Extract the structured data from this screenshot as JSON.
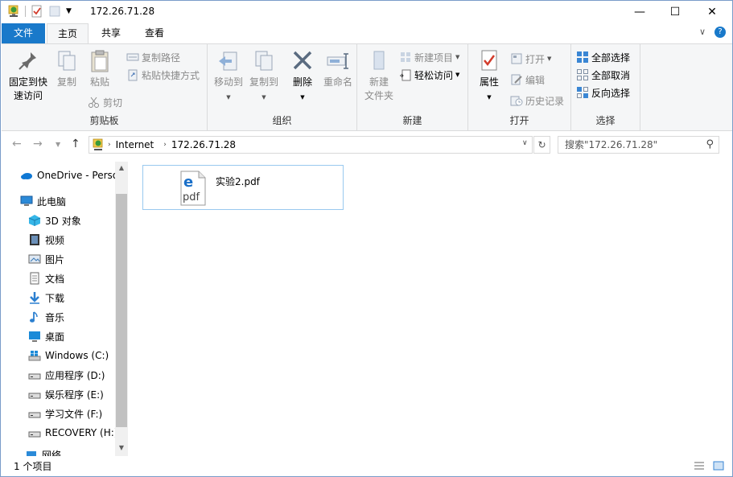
{
  "window": {
    "title": "172.26.71.28",
    "minimize_glyph": "—",
    "maximize_glyph": "☐",
    "close_glyph": "✕"
  },
  "tabs": {
    "file": "文件",
    "home": "主页",
    "share": "共享",
    "view": "查看",
    "collapse_glyph": "∨",
    "help_glyph": "?"
  },
  "ribbon": {
    "clipboard": {
      "label": "剪贴板",
      "pin": "固定到快\n速访问",
      "pin_l1": "固定到快",
      "pin_l2": "速访问",
      "copy": "复制",
      "paste": "粘贴",
      "copy_path": "复制路径",
      "paste_shortcut": "粘贴快捷方式",
      "cut": "剪切"
    },
    "organize": {
      "label": "组织",
      "move_to": "移动到",
      "copy_to": "复制到",
      "delete": "删除",
      "rename": "重命名"
    },
    "new": {
      "label": "新建",
      "new_folder_l1": "新建",
      "new_folder_l2": "文件夹",
      "new_item": "新建项目",
      "easy_access": "轻松访问"
    },
    "open": {
      "label": "打开",
      "properties": "属性",
      "open": "打开",
      "edit": "编辑",
      "history": "历史记录"
    },
    "select": {
      "label": "选择",
      "select_all": "全部选择",
      "select_none": "全部取消",
      "invert": "反向选择"
    }
  },
  "address": {
    "root": "Internet",
    "current": "172.26.71.28",
    "search_placeholder": "搜索\"172.26.71.28\""
  },
  "navpane": {
    "items": [
      {
        "label": "OneDrive - Perso",
        "icon": "cloud-icon"
      },
      {
        "label": "此电脑",
        "icon": "computer-icon"
      },
      {
        "label": "3D 对象",
        "icon": "cube-icon"
      },
      {
        "label": "视频",
        "icon": "video-icon"
      },
      {
        "label": "图片",
        "icon": "picture-icon"
      },
      {
        "label": "文档",
        "icon": "document-icon"
      },
      {
        "label": "下载",
        "icon": "download-icon"
      },
      {
        "label": "音乐",
        "icon": "music-icon"
      },
      {
        "label": "桌面",
        "icon": "desktop-icon"
      },
      {
        "label": "Windows (C:)",
        "icon": "windows-drive-icon"
      },
      {
        "label": "应用程序 (D:)",
        "icon": "drive-icon"
      },
      {
        "label": "娱乐程序 (E:)",
        "icon": "drive-icon"
      },
      {
        "label": "学习文件 (F:)",
        "icon": "drive-icon"
      },
      {
        "label": "RECOVERY (H:)",
        "icon": "drive-icon"
      },
      {
        "label": "网络",
        "icon": "network-icon"
      }
    ]
  },
  "files": [
    {
      "name": "实验2.pdf",
      "icon": "pdf-edge-icon"
    }
  ],
  "status": {
    "count": "1 个项目"
  },
  "colors": {
    "accent": "#1979ca",
    "ribbon_bg": "#f5f6f7",
    "selection_border": "#99c9ef"
  }
}
